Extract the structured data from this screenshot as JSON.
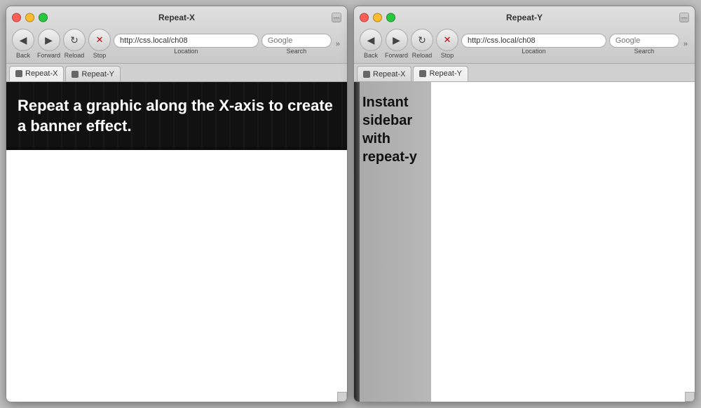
{
  "windows": [
    {
      "id": "repeat-x-window",
      "title": "Repeat-X",
      "tabs": [
        {
          "label": "Repeat-X",
          "active": true
        },
        {
          "label": "Repeat-Y",
          "active": false
        }
      ],
      "toolbar": {
        "back_label": "Back",
        "forward_label": "Forward",
        "reload_label": "Reload",
        "stop_label": "Stop",
        "location_label": "Location",
        "search_label": "Search",
        "location_value": "http://css.local/ch08",
        "search_placeholder": "Google"
      },
      "content": {
        "banner_text": "Repeat a graphic along the X-axis to create a banner effect."
      }
    },
    {
      "id": "repeat-y-window",
      "title": "Repeat-Y",
      "tabs": [
        {
          "label": "Repeat-X",
          "active": false
        },
        {
          "label": "Repeat-Y",
          "active": true
        }
      ],
      "toolbar": {
        "back_label": "Back",
        "forward_label": "Forward",
        "reload_label": "Reload",
        "stop_label": "Stop",
        "location_label": "Location",
        "search_label": "Search",
        "location_value": "http://css.local/ch08",
        "search_placeholder": "Google"
      },
      "content": {
        "sidebar_text": "Instant sidebar with repeat-y"
      }
    }
  ]
}
